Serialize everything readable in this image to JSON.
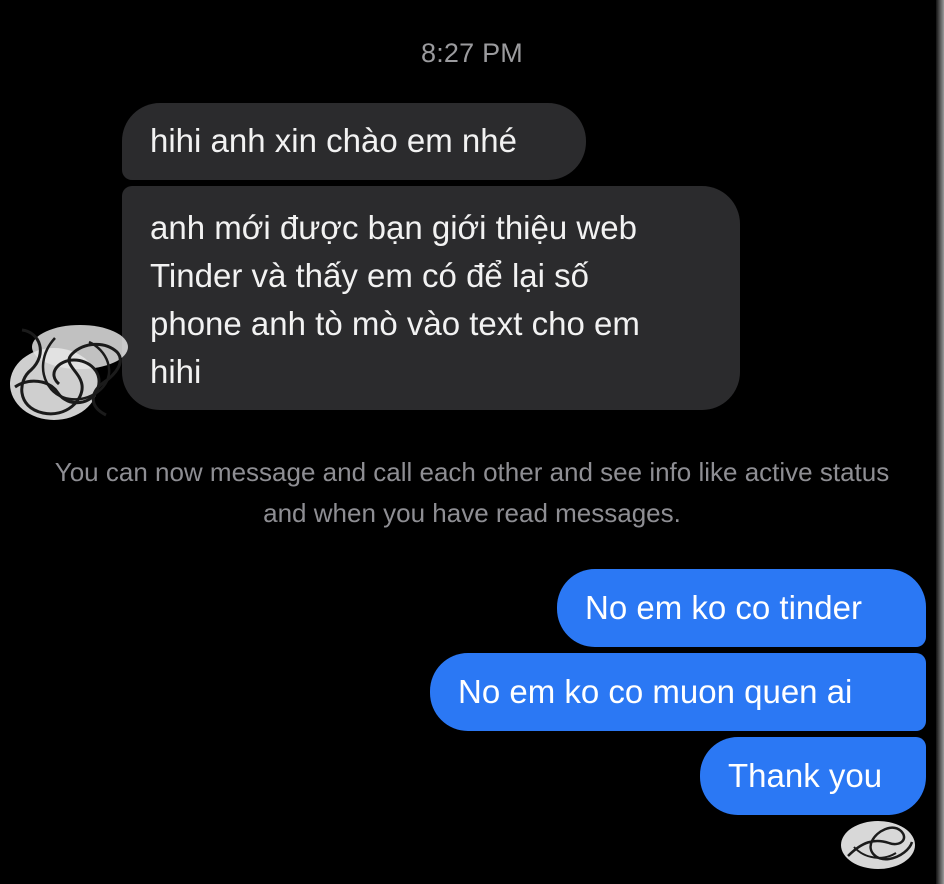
{
  "conversation": {
    "timestamp": "8:27 PM",
    "incoming_messages": [
      "hihi anh xin chào em nhé",
      "anh mới được bạn giới thiệu web\nTinder và thấy em có để lại số\nphone anh tò mò vào text cho em\nhihi"
    ],
    "notice": "You can now message and call each other and see info like\nactive status and when you have read messages.",
    "outgoing_messages": [
      "No em ko co tinder",
      "No em ko co muon quen ai",
      "Thank you"
    ]
  },
  "colors": {
    "background": "#000000",
    "incoming_bubble": "#2b2b2d",
    "outgoing_bubble": "#2b78f4",
    "timestamp_text": "#9b9b9e",
    "notice_text": "#8e8e93"
  },
  "icons": {
    "avatar": "redacted-avatar-scribble",
    "read_receipt": "redacted-read-receipt-scribble"
  }
}
